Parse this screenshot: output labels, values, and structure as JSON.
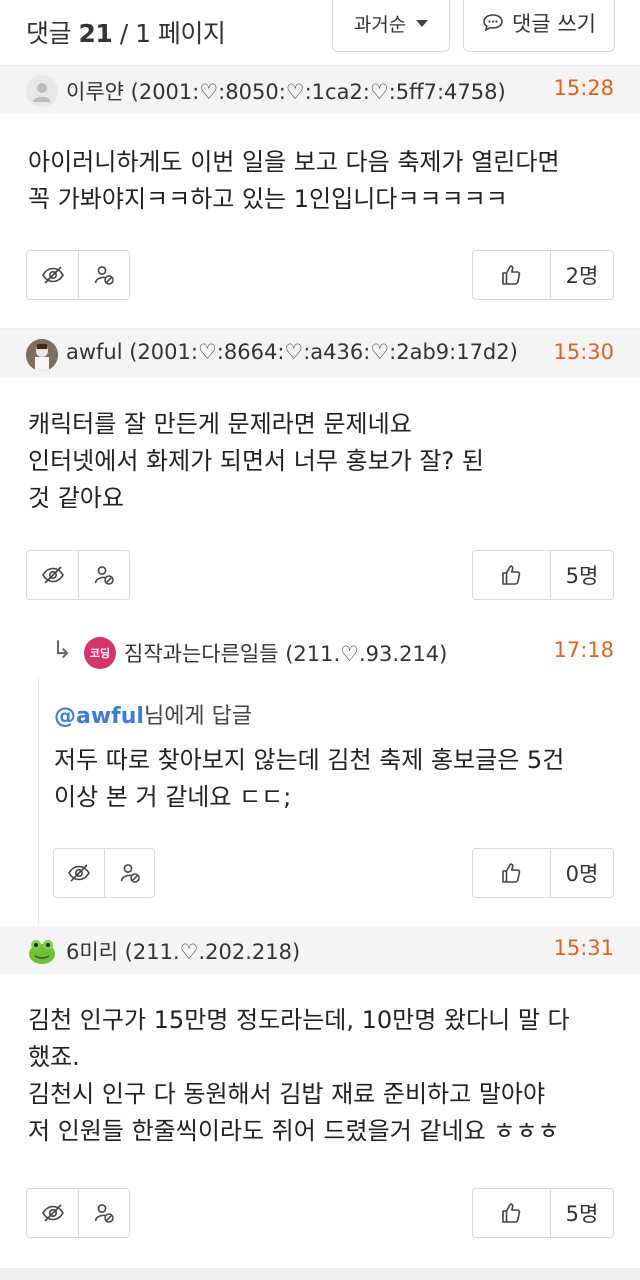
{
  "header": {
    "count_prefix": "댓글 ",
    "count_value": "21",
    "page_info": " / 1 페이지",
    "sort_label": "과거순",
    "write_label": "댓글 쓰기"
  },
  "comments": [
    {
      "author": "이루얀 (2001:♡:8050:♡:1ca2:♡:5ff7:4758)",
      "time": "15:28",
      "lines": [
        "아이러니하게도 이번 일을 보고 다음 축제가 열린다면",
        "꼭 가봐야지ㅋㅋ하고 있는 1인입니다ㅋㅋㅋㅋㅋ"
      ],
      "likes": "2명"
    },
    {
      "author": "awful (2001:♡:8664:♡:a436:♡:2ab9:17d2)",
      "time": "15:30",
      "lines": [
        "캐릭터를 잘 만든게 문제라면 문제네요",
        "인터넷에서 화제가 되면서 너무 홍보가 잘? 된",
        "것 같아요"
      ],
      "likes": "5명"
    },
    {
      "badge": "코딩",
      "author": "짐작과는다른일들 (211.♡.93.214)",
      "time": "17:18",
      "mention_user": "@awful",
      "mention_suffix": "님에게 답글",
      "lines": [
        "저두 따로 찾아보지 않는데 김천 축제 홍보글은 5건",
        "이상 본 거 같네요 ㄷㄷ;"
      ],
      "likes": "0명"
    },
    {
      "author": "6미리 (211.♡.202.218)",
      "time": "15:31",
      "lines": [
        "김천 인구가 15만명 정도라는데, 10만명 왔다니 말 다",
        "했죠.",
        "김천시 인구 다 동원해서 김밥 재료 준비하고 말아야",
        "저 인원들 한줄씩이라도 쥐어 드렸을거 같네요 ㅎㅎㅎ"
      ],
      "likes": "5명"
    }
  ],
  "colors": {
    "time": "#e2621b",
    "mention": "#3d7be0",
    "badge": "#d6336c"
  },
  "icons": [
    "chevron-down-icon",
    "chat-bubble-icon",
    "eye-slash-icon",
    "user-block-icon",
    "thumbs-up-icon",
    "reply-arrow-icon"
  ]
}
